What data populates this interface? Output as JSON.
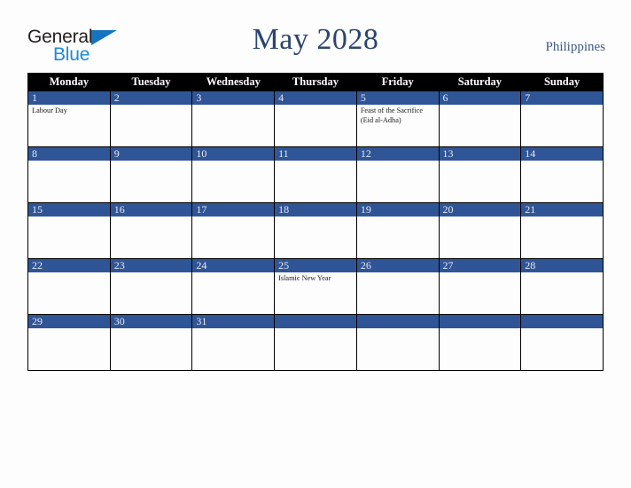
{
  "brand": {
    "name_part1": "General",
    "name_part2": "Blue",
    "triangle_color": "#1673bd",
    "text_color_1": "#231f20",
    "text_color_2": "#1c8ad6"
  },
  "header": {
    "title": "May 2028",
    "country": "Philippines",
    "title_color": "#2b4470",
    "country_color": "#3d5a86"
  },
  "calendar": {
    "weekday_headers": [
      "Monday",
      "Tuesday",
      "Wednesday",
      "Thursday",
      "Friday",
      "Saturday",
      "Sunday"
    ],
    "header_bg": "#000000",
    "header_text": "#ffffff",
    "daynum_bg": "#2f5597",
    "daynum_text": "#e8eaf0",
    "cell_bg": "#fdfdfd",
    "border_color": "#000000",
    "weeks": [
      [
        {
          "day": "1",
          "events": [
            "Labour Day"
          ]
        },
        {
          "day": "2",
          "events": []
        },
        {
          "day": "3",
          "events": []
        },
        {
          "day": "4",
          "events": []
        },
        {
          "day": "5",
          "events": [
            "Feast of the Sacrifice (Eid al-Adha)"
          ]
        },
        {
          "day": "6",
          "events": []
        },
        {
          "day": "7",
          "events": []
        }
      ],
      [
        {
          "day": "8",
          "events": []
        },
        {
          "day": "9",
          "events": []
        },
        {
          "day": "10",
          "events": []
        },
        {
          "day": "11",
          "events": []
        },
        {
          "day": "12",
          "events": []
        },
        {
          "day": "13",
          "events": []
        },
        {
          "day": "14",
          "events": []
        }
      ],
      [
        {
          "day": "15",
          "events": []
        },
        {
          "day": "16",
          "events": []
        },
        {
          "day": "17",
          "events": []
        },
        {
          "day": "18",
          "events": []
        },
        {
          "day": "19",
          "events": []
        },
        {
          "day": "20",
          "events": []
        },
        {
          "day": "21",
          "events": []
        }
      ],
      [
        {
          "day": "22",
          "events": []
        },
        {
          "day": "23",
          "events": []
        },
        {
          "day": "24",
          "events": []
        },
        {
          "day": "25",
          "events": [
            "Islamic New Year"
          ]
        },
        {
          "day": "26",
          "events": []
        },
        {
          "day": "27",
          "events": []
        },
        {
          "day": "28",
          "events": []
        }
      ],
      [
        {
          "day": "29",
          "events": []
        },
        {
          "day": "30",
          "events": []
        },
        {
          "day": "31",
          "events": []
        },
        {
          "day": "",
          "events": []
        },
        {
          "day": "",
          "events": []
        },
        {
          "day": "",
          "events": []
        },
        {
          "day": "",
          "events": []
        }
      ]
    ]
  }
}
